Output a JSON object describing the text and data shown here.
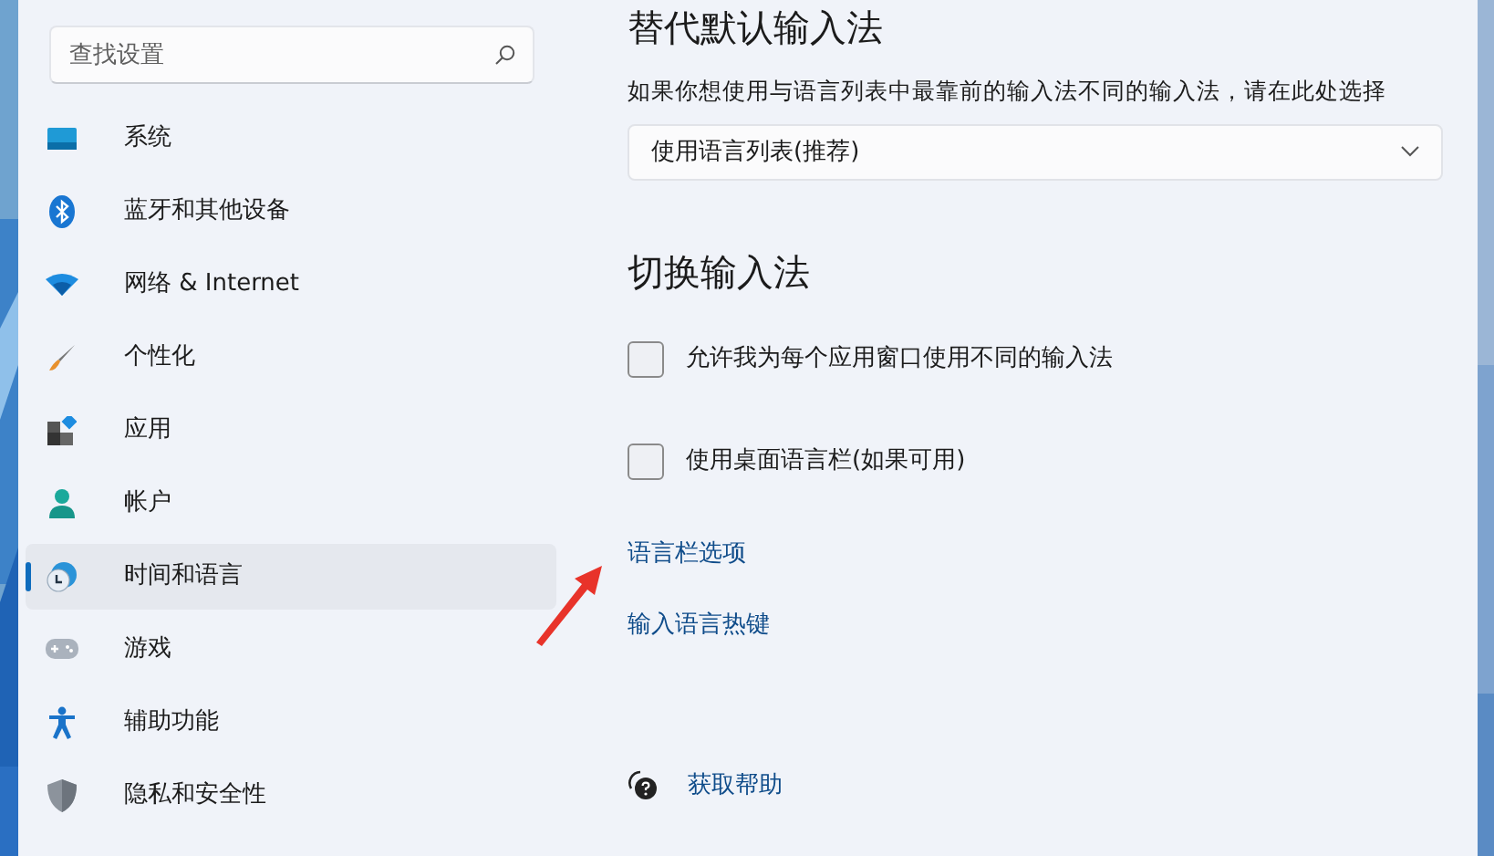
{
  "search": {
    "placeholder": "查找设置"
  },
  "sidebar": {
    "items": [
      {
        "label": "系统",
        "selected": false
      },
      {
        "label": "蓝牙和其他设备",
        "selected": false
      },
      {
        "label": "网络 & Internet",
        "selected": false
      },
      {
        "label": "个性化",
        "selected": false
      },
      {
        "label": "应用",
        "selected": false
      },
      {
        "label": "帐户",
        "selected": false
      },
      {
        "label": "时间和语言",
        "selected": true
      },
      {
        "label": "游戏",
        "selected": false
      },
      {
        "label": "辅助功能",
        "selected": false
      },
      {
        "label": "隐私和安全性",
        "selected": false
      }
    ]
  },
  "sections": [
    {
      "heading": "替代默认输入法",
      "description": "如果你想使用与语言列表中最靠前的输入法不同的输入法，请在此处选择",
      "dropdown": {
        "value": "使用语言列表(推荐)"
      }
    },
    {
      "heading": "切换输入法",
      "checkboxes": [
        {
          "label": "允许我为每个应用窗口使用不同的输入法",
          "checked": false
        },
        {
          "label": "使用桌面语言栏(如果可用)",
          "checked": false
        }
      ],
      "links": [
        "语言栏选项",
        "输入语言热键"
      ]
    }
  ],
  "help_link": "获取帮助"
}
